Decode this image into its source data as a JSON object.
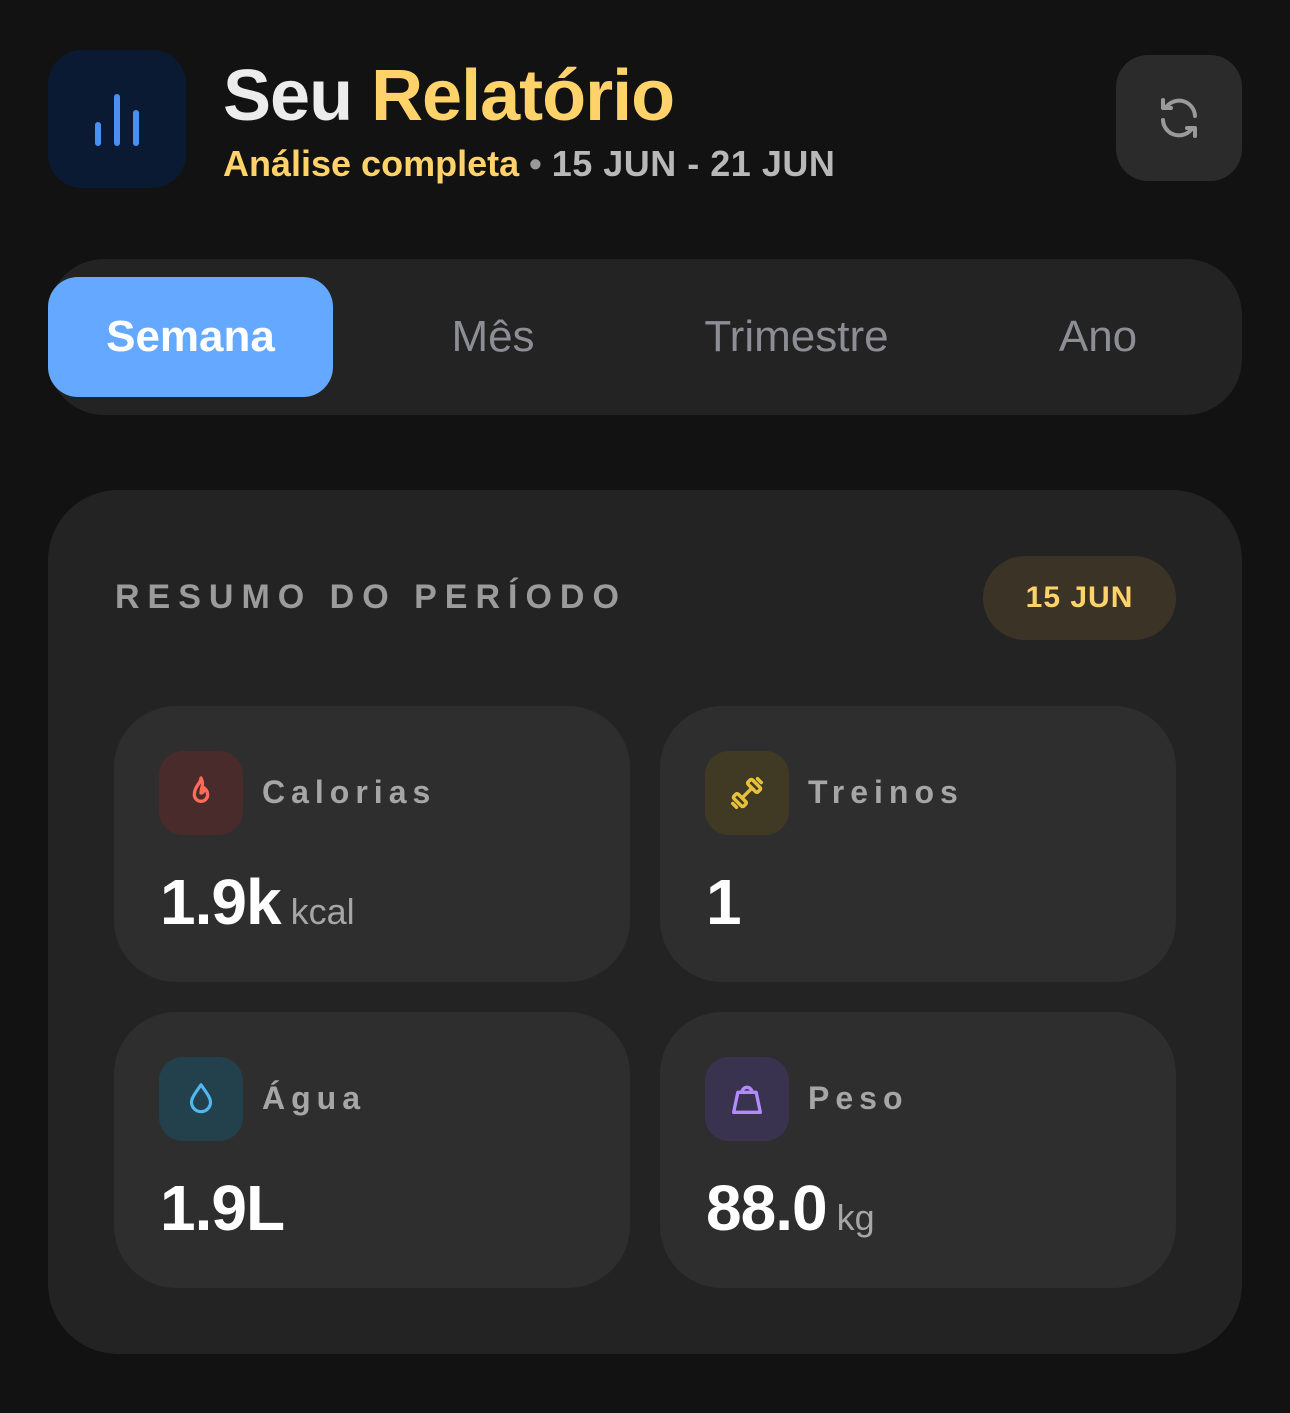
{
  "header": {
    "title_part1": "Seu",
    "title_part2": "Relatório",
    "subtitle_highlight": "Análise completa",
    "subtitle_separator": "•",
    "subtitle_range": "15 JUN - 21 JUN",
    "app_icon": "bar-chart-icon",
    "refresh_icon": "refresh-icon"
  },
  "tabs": [
    {
      "label": "Semana",
      "active": true
    },
    {
      "label": "Mês",
      "active": false
    },
    {
      "label": "Trimestre",
      "active": false
    },
    {
      "label": "Ano",
      "active": false
    }
  ],
  "summary": {
    "title": "RESUMO DO PERÍODO",
    "date_badge": "15 JUN",
    "stats": [
      {
        "label": "Calorias",
        "value": "1.9k",
        "unit": "kcal",
        "icon": "flame-icon",
        "color": "#ff6b5b"
      },
      {
        "label": "Treinos",
        "value": "1",
        "unit": "",
        "icon": "dumbbell-icon",
        "color": "#e8c13a"
      },
      {
        "label": "Água",
        "value": "1.9L",
        "unit": "",
        "icon": "water-drop-icon",
        "color": "#4fb8f0"
      },
      {
        "label": "Peso",
        "value": "88.0",
        "unit": "kg",
        "icon": "weight-icon",
        "color": "#b38bff"
      }
    ]
  },
  "colors": {
    "background": "#121212",
    "accent_yellow": "#ffd36a",
    "accent_blue": "#64a8ff",
    "card": "#232323",
    "tile": "#2e2e2e"
  }
}
